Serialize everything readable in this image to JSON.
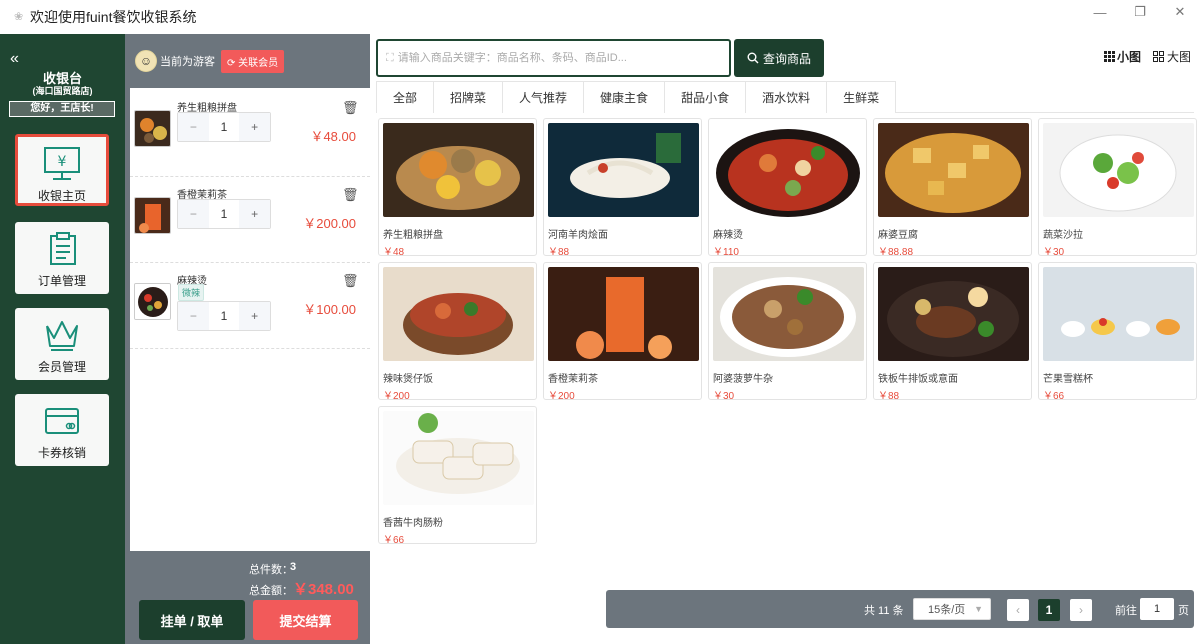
{
  "window": {
    "title": "欢迎使用fuint餐饮收银系统",
    "controls": [
      "—",
      "❐",
      "✕"
    ]
  },
  "sidebar": {
    "collapse_icon": "«",
    "brand": "收银台",
    "store": "(海口国贸路店)",
    "greeting": "您好，王店长!",
    "items": [
      {
        "label": "收银主页",
        "icon": "cashier-icon",
        "active": true
      },
      {
        "label": "订单管理",
        "icon": "clipboard-icon",
        "active": false
      },
      {
        "label": "会员管理",
        "icon": "crown-icon",
        "active": false
      },
      {
        "label": "卡券核销",
        "icon": "card-icon",
        "active": false
      }
    ]
  },
  "cart": {
    "guest_label": "当前为游客",
    "link_member_label": "关联会员",
    "items": [
      {
        "name": "养生粗粮拼盘",
        "qty": "1",
        "price": "￥48.00",
        "tag": ""
      },
      {
        "name": "香橙茉莉茶",
        "qty": "1",
        "price": "￥200.00",
        "tag": ""
      },
      {
        "name": "麻辣烫",
        "qty": "1",
        "price": "￥100.00",
        "tag": "微辣"
      }
    ],
    "total_count_label": "总件数：",
    "total_count": "3",
    "total_amount_label": "总金额：",
    "total_amount": "￥348.00",
    "hang_label": "挂单 / 取单",
    "submit_label": "提交结算"
  },
  "search": {
    "placeholder": "请输入商品关键字：商品名称、条码、商品ID...",
    "button_label": "查询商品"
  },
  "view": {
    "small_label": "小图",
    "large_label": "大图"
  },
  "tabs": [
    "全部",
    "招牌菜",
    "人气推荐",
    "健康主食",
    "甜品小食",
    "酒水饮料",
    "生鲜菜"
  ],
  "products": [
    {
      "name": "养生粗粮拼盘",
      "price": "￥48"
    },
    {
      "name": "河南羊肉烩面",
      "price": "￥88"
    },
    {
      "name": "麻辣烫",
      "price": "￥110"
    },
    {
      "name": "麻婆豆腐",
      "price": "￥88.88"
    },
    {
      "name": "蔬菜沙拉",
      "price": "￥30"
    },
    {
      "name": "辣味煲仔饭",
      "price": "￥200"
    },
    {
      "name": "香橙茉莉茶",
      "price": "￥200"
    },
    {
      "name": "阿婆菠萝牛杂",
      "price": "￥30"
    },
    {
      "name": "铁板牛排饭或意面",
      "price": "￥88"
    },
    {
      "name": "芒果雪糕杯",
      "price": "￥66"
    },
    {
      "name": "香茜牛肉肠粉",
      "price": "￥66"
    }
  ],
  "pagination": {
    "total": "共 11 条",
    "page_size": "15条/页",
    "prev": "‹",
    "current": "1",
    "next": "›",
    "goto_label": "前往",
    "goto_value": "1",
    "page_suffix": "页"
  },
  "colors": {
    "brand_green": "#1f4632",
    "accent_red": "#f25a5a",
    "panel_gray": "#6c757d",
    "price_red": "#e74c3c"
  }
}
